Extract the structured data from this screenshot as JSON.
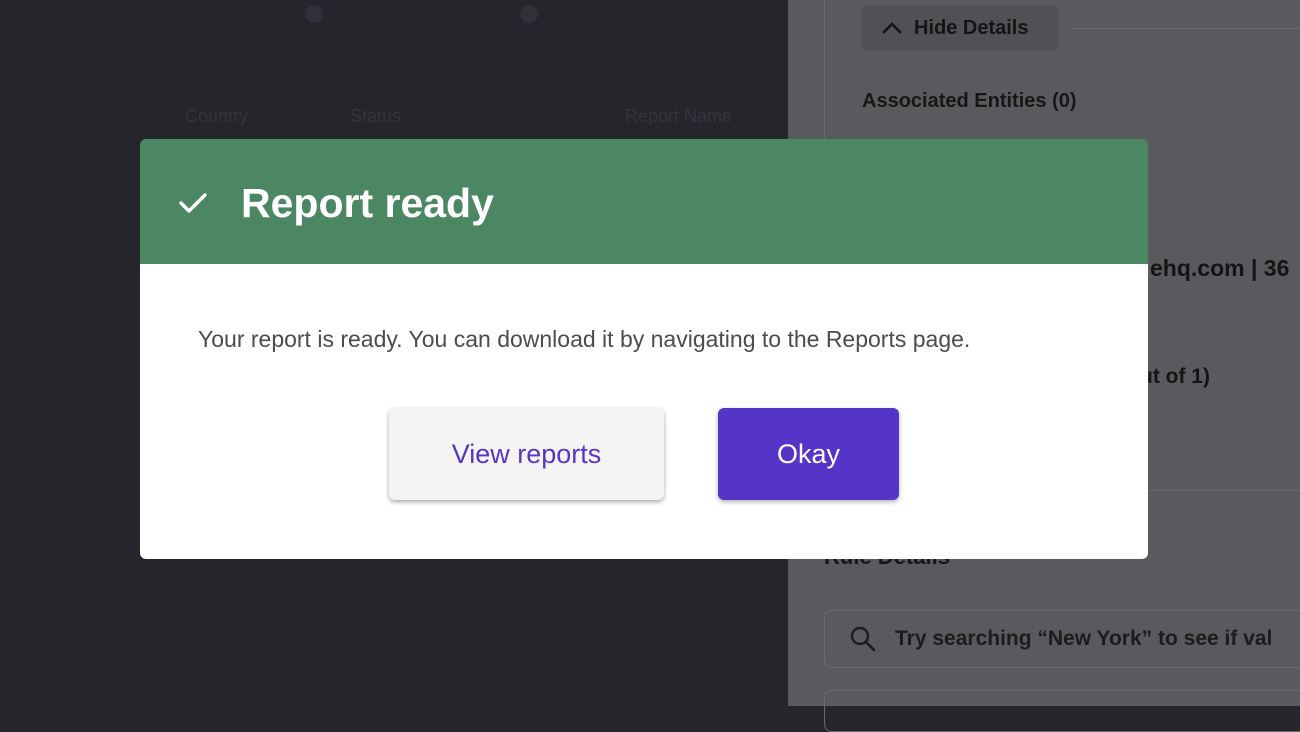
{
  "background": {
    "left_columns": [
      "Country",
      "Status",
      "Report Name"
    ],
    "hide_details_label": "Hide Details",
    "associated_entities_label": "Associated Entities (0)",
    "email_fragment": "ehq.com | 36",
    "count_fragment": "ut of 1)",
    "rule_details_label": "Rule Details",
    "search_placeholder": "Try searching “New York” to see if val"
  },
  "modal": {
    "title": "Report ready",
    "status_icon": "check-icon",
    "message": "Your report is ready. You can download it by navigating to the Reports page.",
    "secondary_button": "View reports",
    "primary_button": "Okay",
    "colors": {
      "header": "#4a8762",
      "primary": "#5535c7",
      "secondary_text": "#5438c4"
    }
  }
}
